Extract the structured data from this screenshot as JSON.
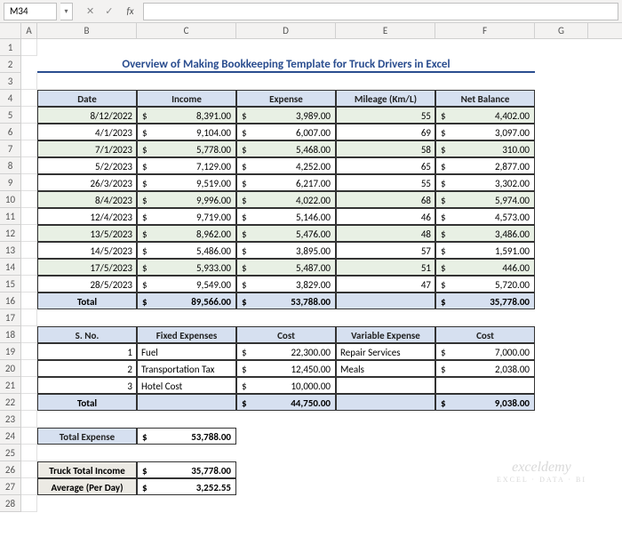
{
  "formula_bar": {
    "name_box": "M34",
    "fx": "fx",
    "cancel": "✕",
    "confirm": "✓"
  },
  "cols": [
    "A",
    "B",
    "C",
    "D",
    "E",
    "F",
    "G"
  ],
  "title": "Overview of Making Bookkeeping Template for Truck Drivers in Excel",
  "table1": {
    "headers": [
      "Date",
      "Income",
      "Expense",
      "Mileage (Km/L)",
      "Net Balance"
    ],
    "rows": [
      {
        "date": "8/12/2022",
        "income": "8,391.00",
        "expense": "3,989.00",
        "mileage": "55",
        "net": "4,402.00",
        "stripe": true
      },
      {
        "date": "4/1/2023",
        "income": "9,104.00",
        "expense": "6,007.00",
        "mileage": "69",
        "net": "3,097.00",
        "stripe": false
      },
      {
        "date": "7/1/2023",
        "income": "5,778.00",
        "expense": "5,468.00",
        "mileage": "58",
        "net": "310.00",
        "stripe": true
      },
      {
        "date": "5/2/2023",
        "income": "7,129.00",
        "expense": "4,252.00",
        "mileage": "65",
        "net": "2,877.00",
        "stripe": false
      },
      {
        "date": "26/3/2023",
        "income": "9,519.00",
        "expense": "6,217.00",
        "mileage": "55",
        "net": "3,302.00",
        "stripe": false
      },
      {
        "date": "8/4/2023",
        "income": "9,996.00",
        "expense": "4,022.00",
        "mileage": "68",
        "net": "5,974.00",
        "stripe": true
      },
      {
        "date": "12/4/2023",
        "income": "9,719.00",
        "expense": "5,146.00",
        "mileage": "46",
        "net": "4,573.00",
        "stripe": false
      },
      {
        "date": "13/5/2023",
        "income": "8,962.00",
        "expense": "5,476.00",
        "mileage": "48",
        "net": "3,486.00",
        "stripe": true
      },
      {
        "date": "14/5/2023",
        "income": "5,486.00",
        "expense": "3,895.00",
        "mileage": "57",
        "net": "1,591.00",
        "stripe": false
      },
      {
        "date": "17/5/2023",
        "income": "5,933.00",
        "expense": "5,487.00",
        "mileage": "51",
        "net": "446.00",
        "stripe": true
      },
      {
        "date": "28/5/2023",
        "income": "9,549.00",
        "expense": "3,829.00",
        "mileage": "47",
        "net": "5,720.00",
        "stripe": false
      }
    ],
    "total": {
      "label": "Total",
      "income": "89,566.00",
      "expense": "53,788.00",
      "net": "35,778.00"
    }
  },
  "table2": {
    "headers": [
      "S. No.",
      "Fixed Expenses",
      "Cost",
      "Variable Expense",
      "Cost"
    ],
    "rows": [
      {
        "sno": "1",
        "fixed": "Fuel",
        "fcost": "22,300.00",
        "variable": "Repair Services",
        "vcost": "7,000.00"
      },
      {
        "sno": "2",
        "fixed": "Transportation Tax",
        "fcost": "12,450.00",
        "variable": "Meals",
        "vcost": "2,038.00"
      },
      {
        "sno": "3",
        "fixed": "Hotel Cost",
        "fcost": "10,000.00",
        "variable": "",
        "vcost": ""
      }
    ],
    "total": {
      "label": "Total",
      "fcost": "44,750.00",
      "vcost": "9,038.00"
    }
  },
  "summary": {
    "total_expense_label": "Total Expense",
    "total_expense": "53,788.00",
    "truck_income_label": "Truck Total Income",
    "truck_income": "35,778.00",
    "avg_label": "Average (Per Day)",
    "avg": "3,252.55"
  },
  "watermark": {
    "main": "exceldemy",
    "sub": "EXCEL · DATA · BI"
  },
  "currency": "$"
}
